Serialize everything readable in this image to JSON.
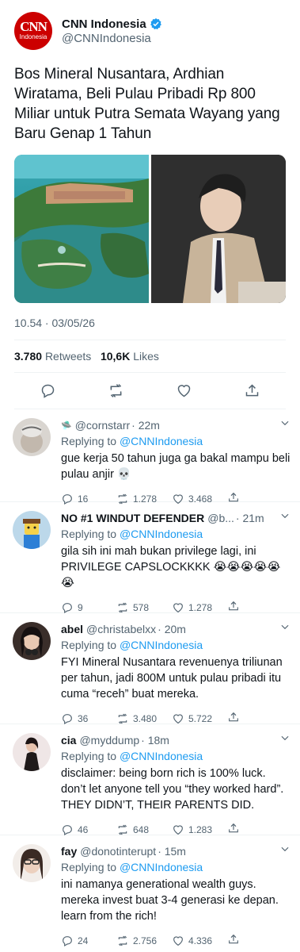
{
  "main": {
    "logo_text": "CNN",
    "logo_subtext": "Indonesia",
    "display_name": "CNN Indonesia",
    "handle": "@CNNIndonesia",
    "text": "Bos Mineral Nusantara, Ardhian Wiratama, Beli Pulau Pribadi Rp 800 Miliar untuk Putra Semata Wayang yang Baru Genap 1 Tahun",
    "timestamp": "10.54 · 03/05/26",
    "retweets_count": "3.780",
    "retweets_label": "Retweets",
    "likes_count": "10,6K",
    "likes_label": "Likes"
  },
  "replies": [
    {
      "name": "",
      "handle": "@cornstarr",
      "time": "· 22m",
      "replying_label": "Replying to",
      "mention": "@CNNIndonesia",
      "text": "gue kerja 50 tahun juga ga bakal mampu beli pulau anjir 💀",
      "replies": "16",
      "retweets": "1.278",
      "likes": "3.468"
    },
    {
      "name": "NO #1 WINDUT DEFENDER",
      "handle": "@b...",
      "time": "· 21m",
      "replying_label": "Replying to",
      "mention": "@CNNIndonesia",
      "text": "gila sih ini mah bukan privilege lagi, ini PRIVILEGE CAPSLOCKKKK 😭😭😭😭😭😭",
      "replies": "9",
      "retweets": "578",
      "likes": "1.278"
    },
    {
      "name": "abel",
      "handle": "@christabelxx",
      "time": "· 20m",
      "replying_label": "Replying to",
      "mention": "@CNNIndonesia",
      "text": "FYI Mineral Nusantara revenuenya triliunan per tahun, jadi 800M untuk pulau pribadi itu cuma “receh” buat mereka.",
      "replies": "36",
      "retweets": "3.480",
      "likes": "5.722"
    },
    {
      "name": "cia",
      "handle": "@myddump",
      "time": "· 18m",
      "replying_label": "Replying to",
      "mention": "@CNNIndonesia",
      "text": "disclaimer: being born rich is 100% luck. don’t let anyone tell you “they worked hard”. THEY DIDN’T, THEIR PARENTS DID.",
      "replies": "46",
      "retweets": "648",
      "likes": "1.283"
    },
    {
      "name": "fay",
      "handle": "@donotinterupt",
      "time": "· 15m",
      "replying_label": "Replying to",
      "mention": "@CNNIndonesia",
      "text": "ini namanya generational wealth guys. mereka invest buat 3-4 generasi ke depan. learn from the rich!",
      "replies": "24",
      "retweets": "2.756",
      "likes": "4.336"
    }
  ],
  "colors": {
    "accent": "#1d9bf0",
    "cnn_red": "#cc0000",
    "muted": "#536471"
  },
  "icons": [
    "verified-badge-icon",
    "reply-icon",
    "retweet-icon",
    "like-icon",
    "share-icon",
    "chevron-down-icon"
  ]
}
